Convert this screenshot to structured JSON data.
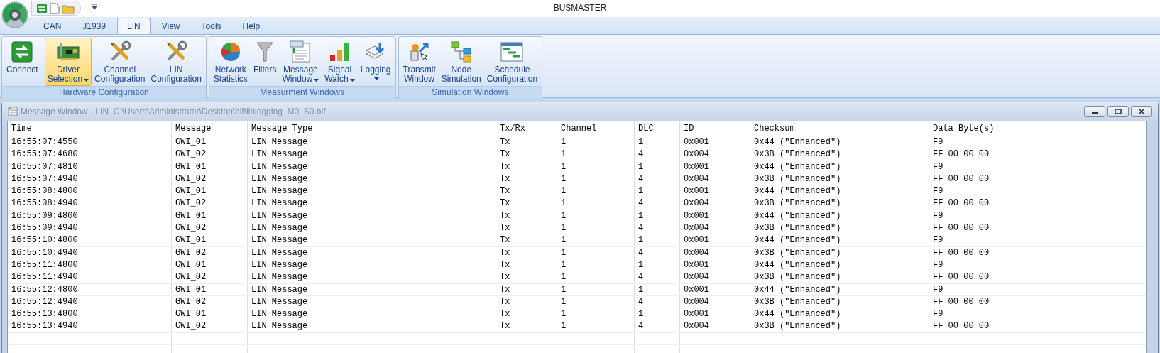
{
  "app_title": "BUSMASTER",
  "tabs": [
    {
      "label": "CAN",
      "selected": false
    },
    {
      "label": "J1939",
      "selected": false
    },
    {
      "label": "LIN",
      "selected": true
    },
    {
      "label": "View",
      "selected": false
    },
    {
      "label": "Tools",
      "selected": false
    },
    {
      "label": "Help",
      "selected": false
    }
  ],
  "ribbon_groups": [
    {
      "title": "Hardware Configuration",
      "buttons": [
        {
          "label": "Connect",
          "selected": false,
          "has_menu": false
        },
        {
          "label": "Driver\nSelection",
          "selected": true,
          "has_menu": true
        },
        {
          "label": "Channel\nConfiguration",
          "selected": false,
          "has_menu": false
        },
        {
          "label": "LIN\nConfiguration",
          "selected": false,
          "has_menu": false
        }
      ]
    },
    {
      "title": "Measurment Windows",
      "buttons": [
        {
          "label": "Network\nStatistics",
          "selected": false,
          "has_menu": false
        },
        {
          "label": "Filters",
          "selected": false,
          "has_menu": false
        },
        {
          "label": "Message\nWindow",
          "selected": false,
          "has_menu": true
        },
        {
          "label": "Signal\nWatch",
          "selected": false,
          "has_menu": true
        },
        {
          "label": "Logging",
          "selected": false,
          "has_menu": true
        }
      ]
    },
    {
      "title": "Simulation Windows",
      "buttons": [
        {
          "label": "Transmit\nWindow",
          "selected": false,
          "has_menu": false
        },
        {
          "label": "Node\nSimulation",
          "selected": false,
          "has_menu": false
        },
        {
          "label": "Schedule\nConfiguration",
          "selected": false,
          "has_menu": false
        }
      ]
    }
  ],
  "message_window": {
    "title": "Message Window - LIN  C:\\Users\\Administrator\\Desktop\\blf\\linlogging_M0_S0.blf",
    "columns": [
      "Time",
      "Message",
      "Message Type",
      "Tx/Rx",
      "Channel",
      "DLC",
      "ID",
      "Checksum",
      "Data Byte(s)"
    ],
    "rows": [
      [
        "16:55:07:4550",
        "GWI_01",
        "LIN Message",
        "Tx",
        "1",
        "1",
        "0x001",
        "0x44 (\"Enhanced\")",
        "F9"
      ],
      [
        "16:55:07:4680",
        "GWI_02",
        "LIN Message",
        "Tx",
        "1",
        "4",
        "0x004",
        "0x3B (\"Enhanced\")",
        "FF 00 00 00"
      ],
      [
        "16:55:07:4810",
        "GWI_01",
        "LIN Message",
        "Tx",
        "1",
        "1",
        "0x001",
        "0x44 (\"Enhanced\")",
        "F9"
      ],
      [
        "16:55:07:4940",
        "GWI_02",
        "LIN Message",
        "Tx",
        "1",
        "4",
        "0x004",
        "0x3B (\"Enhanced\")",
        "FF 00 00 00"
      ],
      [
        "16:55:08:4800",
        "GWI_01",
        "LIN Message",
        "Tx",
        "1",
        "1",
        "0x001",
        "0x44 (\"Enhanced\")",
        "F9"
      ],
      [
        "16:55:08:4940",
        "GWI_02",
        "LIN Message",
        "Tx",
        "1",
        "4",
        "0x004",
        "0x3B (\"Enhanced\")",
        "FF 00 00 00"
      ],
      [
        "16:55:09:4800",
        "GWI_01",
        "LIN Message",
        "Tx",
        "1",
        "1",
        "0x001",
        "0x44 (\"Enhanced\")",
        "F9"
      ],
      [
        "16:55:09:4940",
        "GWI_02",
        "LIN Message",
        "Tx",
        "1",
        "4",
        "0x004",
        "0x3B (\"Enhanced\")",
        "FF 00 00 00"
      ],
      [
        "16:55:10:4800",
        "GWI_01",
        "LIN Message",
        "Tx",
        "1",
        "1",
        "0x001",
        "0x44 (\"Enhanced\")",
        "F9"
      ],
      [
        "16:55:10:4940",
        "GWI_02",
        "LIN Message",
        "Tx",
        "1",
        "4",
        "0x004",
        "0x3B (\"Enhanced\")",
        "FF 00 00 00"
      ],
      [
        "16:55:11:4800",
        "GWI_01",
        "LIN Message",
        "Tx",
        "1",
        "1",
        "0x001",
        "0x44 (\"Enhanced\")",
        "F9"
      ],
      [
        "16:55:11:4940",
        "GWI_02",
        "LIN Message",
        "Tx",
        "1",
        "4",
        "0x004",
        "0x3B (\"Enhanced\")",
        "FF 00 00 00"
      ],
      [
        "16:55:12:4800",
        "GWI_01",
        "LIN Message",
        "Tx",
        "1",
        "1",
        "0x001",
        "0x44 (\"Enhanced\")",
        "F9"
      ],
      [
        "16:55:12:4940",
        "GWI_02",
        "LIN Message",
        "Tx",
        "1",
        "4",
        "0x004",
        "0x3B (\"Enhanced\")",
        "FF 00 00 00"
      ],
      [
        "16:55:13:4800",
        "GWI_01",
        "LIN Message",
        "Tx",
        "1",
        "1",
        "0x001",
        "0x44 (\"Enhanced\")",
        "F9"
      ],
      [
        "16:55:13:4940",
        "GWI_02",
        "LIN Message",
        "Tx",
        "1",
        "4",
        "0x004",
        "0x3B (\"Enhanced\")",
        "FF 00 00 00"
      ]
    ]
  }
}
